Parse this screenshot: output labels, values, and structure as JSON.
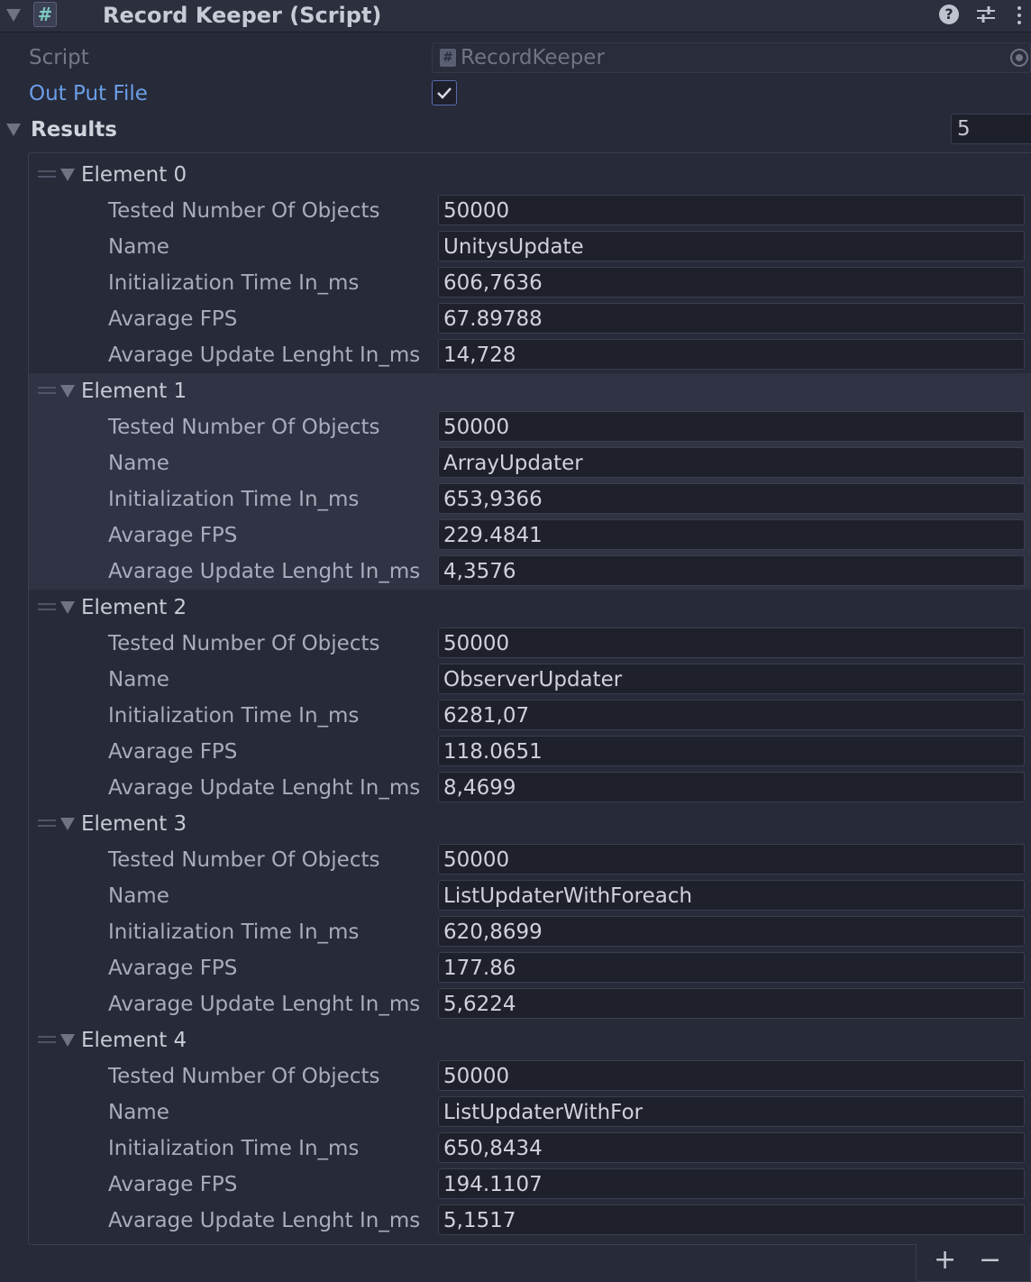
{
  "header": {
    "title": "Record Keeper (Script)",
    "icons": [
      "foldout-arrow-icon",
      "script-hash-icon",
      "help-icon",
      "sliders-icon",
      "kebab-menu-icon"
    ]
  },
  "script_field": {
    "label": "Script",
    "value": "RecordKeeper"
  },
  "output_file": {
    "label": "Out Put File",
    "checked": true
  },
  "results": {
    "label": "Results",
    "count": "5",
    "elements": [
      {
        "title": "Element 0",
        "fields": [
          {
            "label": "Tested Number Of Objects",
            "value": "50000"
          },
          {
            "label": "Name",
            "value": "UnitysUpdate"
          },
          {
            "label": "Initialization Time In_ms",
            "value": "606,7636"
          },
          {
            "label": "Avarage FPS",
            "value": "67.89788"
          },
          {
            "label": "Avarage Update Lenght In_ms",
            "value": "14,728"
          }
        ]
      },
      {
        "title": "Element 1",
        "fields": [
          {
            "label": "Tested Number Of Objects",
            "value": "50000"
          },
          {
            "label": "Name",
            "value": "ArrayUpdater"
          },
          {
            "label": "Initialization Time In_ms",
            "value": "653,9366"
          },
          {
            "label": "Avarage FPS",
            "value": "229.4841"
          },
          {
            "label": "Avarage Update Lenght In_ms",
            "value": "4,3576"
          }
        ]
      },
      {
        "title": "Element 2",
        "fields": [
          {
            "label": "Tested Number Of Objects",
            "value": "50000"
          },
          {
            "label": "Name",
            "value": "ObserverUpdater"
          },
          {
            "label": "Initialization Time In_ms",
            "value": "6281,07"
          },
          {
            "label": "Avarage FPS",
            "value": "118.0651"
          },
          {
            "label": "Avarage Update Lenght In_ms",
            "value": "8,4699"
          }
        ]
      },
      {
        "title": "Element 3",
        "fields": [
          {
            "label": "Tested Number Of Objects",
            "value": "50000"
          },
          {
            "label": "Name",
            "value": "ListUpdaterWithForeach"
          },
          {
            "label": "Initialization Time In_ms",
            "value": "620,8699"
          },
          {
            "label": "Avarage FPS",
            "value": "177.86"
          },
          {
            "label": "Avarage Update Lenght In_ms",
            "value": "5,6224"
          }
        ]
      },
      {
        "title": "Element 4",
        "fields": [
          {
            "label": "Tested Number Of Objects",
            "value": "50000"
          },
          {
            "label": "Name",
            "value": "ListUpdaterWithFor"
          },
          {
            "label": "Initialization Time In_ms",
            "value": "650,8434"
          },
          {
            "label": "Avarage FPS",
            "value": "194.1107"
          },
          {
            "label": "Avarage Update Lenght In_ms",
            "value": "5,1517"
          }
        ]
      }
    ]
  },
  "footer": {
    "add": "+",
    "remove": "−"
  },
  "colors": {
    "background": "#272a38",
    "highlight_row": "#2f3344",
    "link_blue": "#6b9ee8",
    "field": "#1e202b"
  }
}
